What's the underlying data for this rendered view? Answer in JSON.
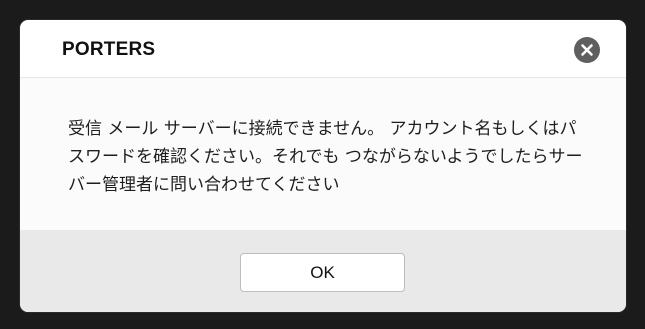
{
  "dialog": {
    "title": "PORTERS",
    "message": "受信 メール サーバーに接続できません。 アカウント名もしくはパスワードを確認ください。それでも つながらないようでしたらサーバー管理者に問い合わせてください",
    "ok_label": "OK",
    "close_icon": "close-circle-icon"
  },
  "colors": {
    "backdrop": "#1b1b1b",
    "dialog_bg": "#ffffff",
    "footer_bg": "#e9e9e9",
    "close_bg": "#5f5f5f"
  }
}
